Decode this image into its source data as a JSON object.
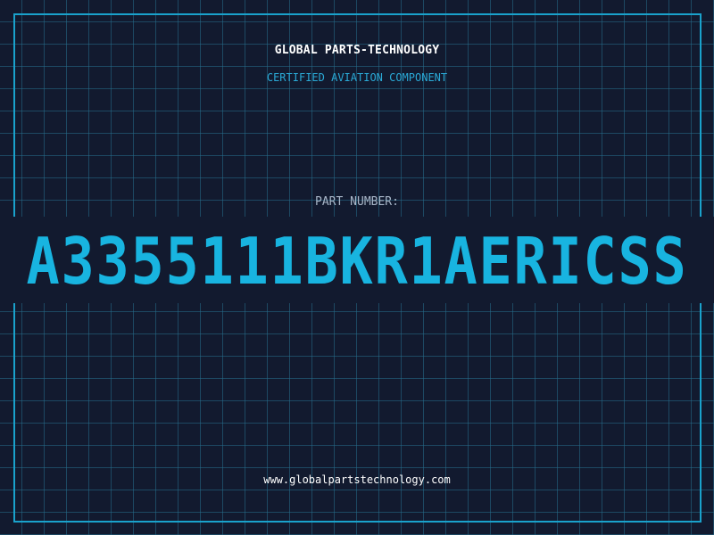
{
  "header": {
    "company": "GLOBAL PARTS-TECHNOLOGY",
    "subtitle": "CERTIFIED AVIATION COMPONENT"
  },
  "part": {
    "label": "PART NUMBER:",
    "number": "A3355111BKR1AERICSS"
  },
  "footer": {
    "url": "www.globalpartstechnology.com"
  },
  "colors": {
    "background": "#121a2f",
    "grid": "#266e8c",
    "frame": "#1aa2cc",
    "accent": "#18b4e0",
    "subtitle": "#2aa9d6",
    "label": "#a8b6c8",
    "text": "#ffffff"
  }
}
